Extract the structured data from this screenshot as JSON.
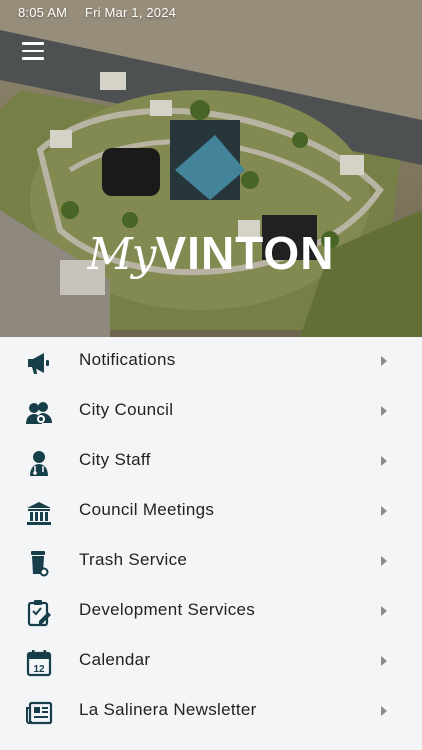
{
  "status_bar": {
    "time": "8:05 AM",
    "date": "Fri Mar 1, 2024"
  },
  "hero": {
    "logo_my": "My",
    "logo_name": "VINTON"
  },
  "colors": {
    "icon": "#173f4a",
    "chevron": "#8a8a8a",
    "text": "#222222"
  },
  "menu": {
    "items": [
      {
        "label": "Notifications",
        "icon": "megaphone-icon"
      },
      {
        "label": "City Council",
        "icon": "council-icon"
      },
      {
        "label": "City Staff",
        "icon": "staff-icon"
      },
      {
        "label": "Council Meetings",
        "icon": "building-icon"
      },
      {
        "label": "Trash Service",
        "icon": "trash-bin-icon"
      },
      {
        "label": "Development Services",
        "icon": "clipboard-icon"
      },
      {
        "label": "Calendar",
        "icon": "calendar-icon"
      },
      {
        "label": "La Salinera Newsletter",
        "icon": "newspaper-icon"
      }
    ]
  }
}
